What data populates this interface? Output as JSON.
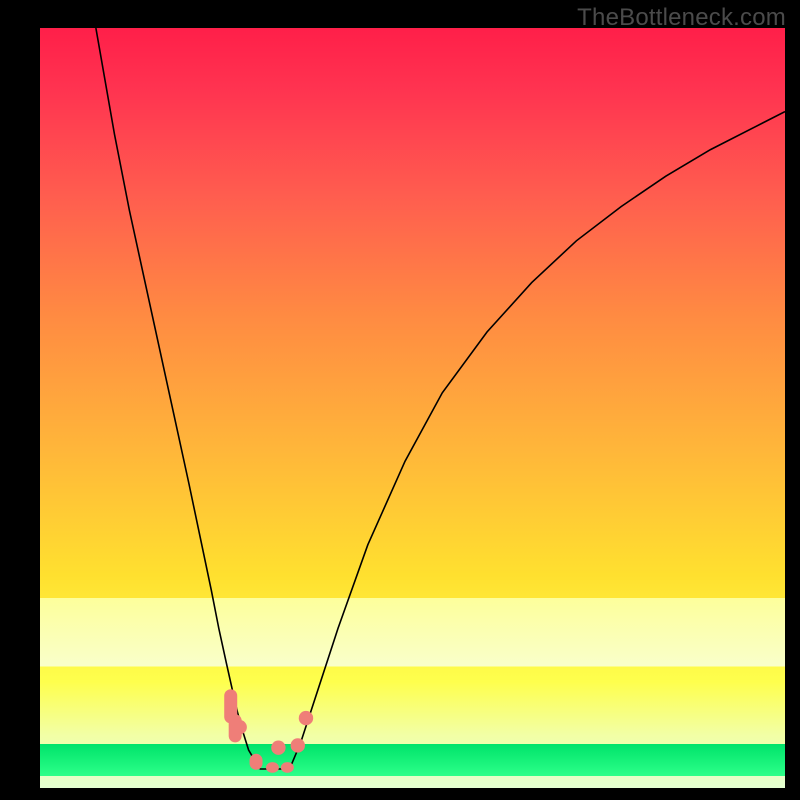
{
  "watermark": "TheBottleneck.com",
  "colors": {
    "background_black": "#000000",
    "gradient_top": "#ff1f49",
    "gradient_mid": "#ffe02f",
    "gradient_bottom": "#e3ffd0",
    "pale_band": "#fdff9b",
    "green_strip": "#00e36a",
    "curve": "#000000",
    "marker": "#ef7e78"
  },
  "chart_data": {
    "type": "line",
    "title": "",
    "xlabel": "",
    "ylabel": "",
    "xlim": [
      0,
      100
    ],
    "ylim": [
      0,
      100
    ],
    "series": [
      {
        "name": "left-curve",
        "x": [
          7.5,
          10,
          12,
          14,
          16,
          18,
          20,
          21.5,
          23,
          24,
          25,
          25.8,
          26.5,
          27.2,
          28,
          29.5
        ],
        "values": [
          100,
          86,
          76,
          67,
          58,
          49,
          40,
          33,
          26,
          21,
          16.5,
          13,
          10,
          7.5,
          5,
          2.5
        ]
      },
      {
        "name": "right-curve",
        "x": [
          33.5,
          35,
          37,
          40,
          44,
          49,
          54,
          60,
          66,
          72,
          78,
          84,
          90,
          96,
          100
        ],
        "values": [
          2.5,
          6,
          12,
          21,
          32,
          43,
          52,
          60,
          66.5,
          72,
          76.5,
          80.5,
          84,
          87,
          89
        ]
      }
    ],
    "flat_bottom": {
      "x_start": 29.5,
      "x_end": 33.5,
      "y": 2.5
    },
    "markers_round": [
      {
        "x": 26.8,
        "y": 8.0
      },
      {
        "x": 32.0,
        "y": 5.3
      },
      {
        "x": 34.6,
        "y": 5.6
      },
      {
        "x": 35.7,
        "y": 9.2
      }
    ],
    "markers_pill": [
      {
        "x": 25.6,
        "y_top": 13.0,
        "y_bot": 8.5
      },
      {
        "x": 26.2,
        "y_top": 9.7,
        "y_bot": 6.0
      },
      {
        "x": 29.0,
        "y_top": 4.5,
        "y_bot": 2.4
      },
      {
        "x": 31.2,
        "y_top": 3.4,
        "y_bot": 2.0
      },
      {
        "x": 33.2,
        "y_top": 3.4,
        "y_bot": 2.0
      }
    ]
  }
}
